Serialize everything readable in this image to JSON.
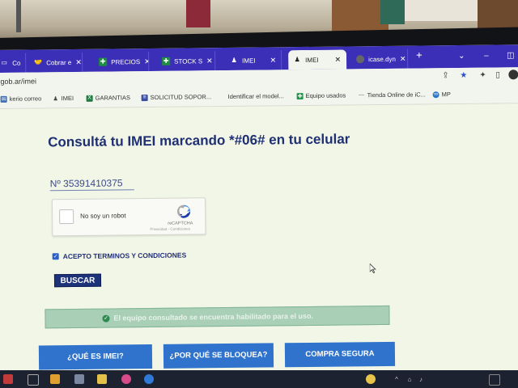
{
  "browser": {
    "tabs": [
      {
        "label": "Co",
        "icon": "page-icon",
        "active": false
      },
      {
        "label": "Cobrar e",
        "icon": "handshake-icon",
        "active": false
      },
      {
        "label": "PRECIOS",
        "icon": "sheets-icon",
        "active": false
      },
      {
        "label": "STOCK S",
        "icon": "sheets-icon",
        "active": false
      },
      {
        "label": "IMEI",
        "icon": "person-icon",
        "active": false
      },
      {
        "label": "IMEI",
        "icon": "person-icon",
        "active": true
      },
      {
        "label": "icase.dyn",
        "icon": "globe-icon",
        "active": false
      }
    ],
    "new_tab": "+",
    "url": "gob.ar/imei",
    "bookmarks": [
      {
        "label": "kerio correo",
        "icon": "mail-icon",
        "color": "#3a6fb5"
      },
      {
        "label": "IMEI",
        "icon": "person-icon",
        "color": "#444444"
      },
      {
        "label": "GARANTIAS",
        "icon": "excel-icon",
        "color": "#1f7a40"
      },
      {
        "label": "SOLICITUD SOPOR...",
        "icon": "doc-icon",
        "color": "#3a4ea5"
      },
      {
        "label": "Identificar el model...",
        "icon": "apple-icon",
        "color": "#333333"
      },
      {
        "label": "Equipo usados",
        "icon": "sheets-icon",
        "color": "#1f9a4a"
      },
      {
        "label": "Tienda Online de iC...",
        "icon": "dash-icon",
        "color": "#777777"
      },
      {
        "label": "MP",
        "icon": "mercadopago-icon",
        "color": "#2a78c9"
      }
    ]
  },
  "page": {
    "title": "Consultá tu IMEI marcando *#06# en tu celular",
    "imei_value": "Nº 35391410375",
    "captcha": {
      "label": "No soy un robot",
      "brand": "reCAPTCHA",
      "terms": "Privacidad - Condiciones"
    },
    "terms_label": "ACEPTO TERMINOS Y CONDICIONES",
    "search_button": "BUSCAR",
    "status_message": "El equipo consultado se encuentra habilitado para el uso.",
    "buttons": [
      "¿QUÉ ES IMEI?",
      "¿POR QUÉ SE BLOQUEA?",
      "COMPRA SEGURA"
    ]
  },
  "colors": {
    "tab_bar": "#3b2fb8",
    "title": "#1f2f74",
    "button_primary": "#1e3279",
    "button_secondary": "#2f73cc",
    "status_bg": "#a9cfb6"
  }
}
